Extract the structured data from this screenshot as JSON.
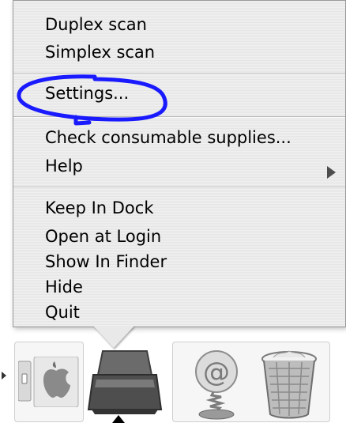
{
  "context_menu": {
    "items": [
      {
        "label": "Duplex scan"
      },
      {
        "label": "Simplex scan"
      },
      {
        "label": "Settings..."
      },
      {
        "label": "Check consumable supplies..."
      },
      {
        "label": "Help",
        "has_submenu": true
      },
      {
        "label": "Keep In Dock"
      },
      {
        "label": "Open at Login"
      },
      {
        "label": "Show In Finder"
      },
      {
        "label": "Hide"
      },
      {
        "label": "Quit"
      }
    ],
    "highlight_annotation": {
      "target": "Settings...",
      "color": "#1a1aff"
    }
  },
  "dock": {
    "items": [
      {
        "icon": "finder-apple-icon"
      },
      {
        "icon": "scanner-app-icon",
        "running": true
      },
      {
        "icon": "mail-at-icon"
      },
      {
        "icon": "trash-icon"
      }
    ]
  },
  "colors": {
    "menu_background": "#ececec",
    "annotation": "#1a1aff",
    "text": "#000000"
  }
}
